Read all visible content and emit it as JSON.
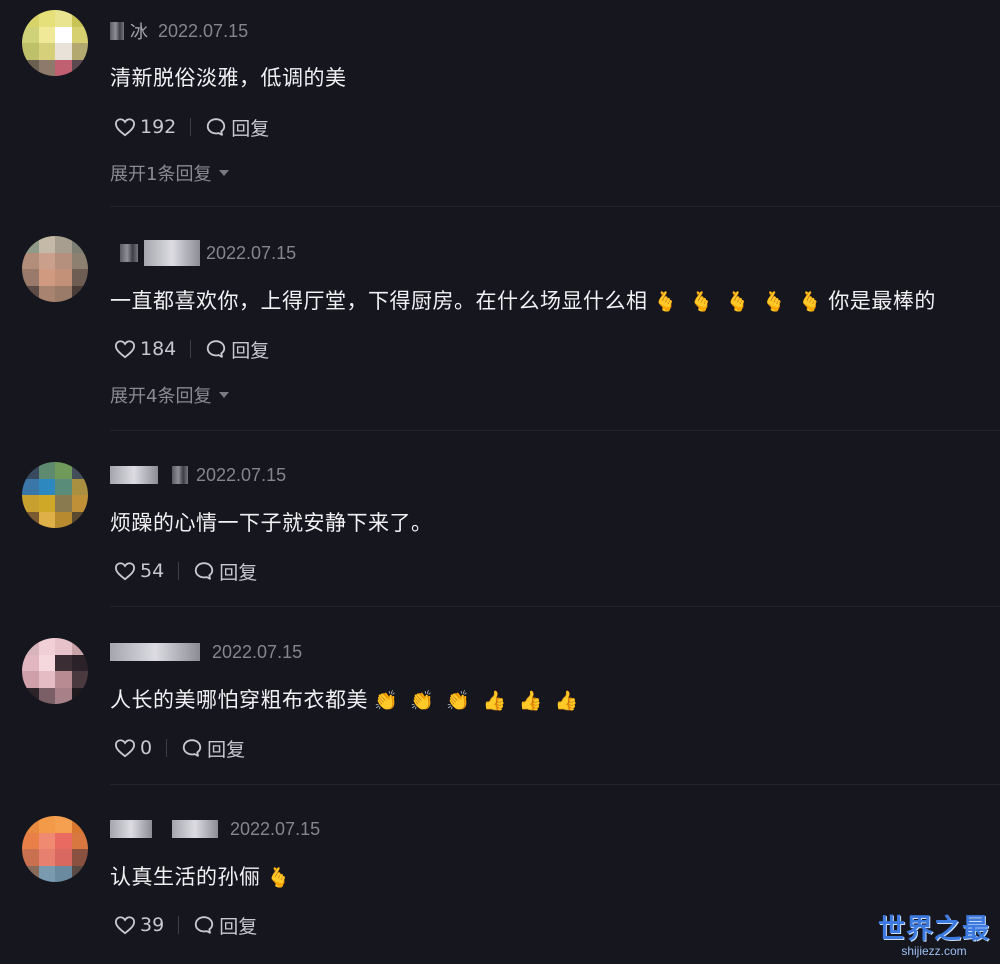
{
  "labels": {
    "reply": "回复"
  },
  "comments": [
    {
      "username_tail": "冰",
      "date": "2022.07.15",
      "text": "清新脱俗淡雅，低调的美",
      "likes": "192",
      "expand": "展开1条回复"
    },
    {
      "username_tail": "",
      "date": "2022.07.15",
      "text": "一直都喜欢你，上得厅堂，下得厨房。在什么场显什么相",
      "text_after": "你是最棒的",
      "likes": "184",
      "expand": "展开4条回复"
    },
    {
      "username_tail": "",
      "date": "2022.07.15",
      "text": "烦躁的心情一下子就安静下来了。",
      "likes": "54"
    },
    {
      "username_tail": "",
      "date": "2022.07.15",
      "text": "人长的美哪怕穿粗布衣都美",
      "likes": "0"
    },
    {
      "username_tail": "",
      "date": "2022.07.15",
      "text": "认真生活的孙俪",
      "likes": "39"
    }
  ],
  "watermark": {
    "title": "世界之最",
    "url": "shijiezz.com"
  },
  "colors": {
    "background": "#16161e",
    "text": "#f1f1f4",
    "meta": "#85858f",
    "watermark": "#3d7ae0"
  },
  "icons": {
    "like": "heart-outline-icon",
    "reply": "speech-bubble-icon",
    "expand": "caret-down-icon"
  }
}
